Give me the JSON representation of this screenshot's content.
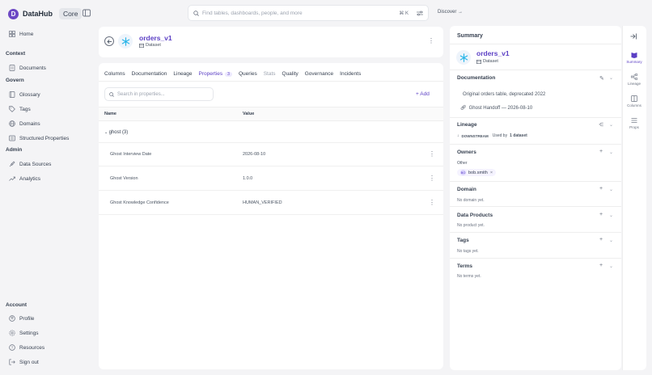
{
  "brand": {
    "name": "DataHub",
    "edition": "Core"
  },
  "search": {
    "placeholder": "Find tables, dashboards, people, and more",
    "shortcut": "⌘ K"
  },
  "discover_label": "Discover →",
  "sidebar": {
    "home": "Home",
    "context_header": "Context",
    "documents": "Documents",
    "govern_header": "Govern",
    "glossary": "Glossary",
    "tags": "Tags",
    "domains": "Domains",
    "structured_properties": "Structured Properties",
    "admin_header": "Admin",
    "data_sources": "Data Sources",
    "analytics": "Analytics",
    "account_header": "Account",
    "profile": "Profile",
    "settings": "Settings",
    "resources": "Resources",
    "sign_out": "Sign out"
  },
  "entity": {
    "name": "orders_v1",
    "type": "Dataset"
  },
  "tabs": [
    {
      "label": "Columns"
    },
    {
      "label": "Documentation"
    },
    {
      "label": "Lineage"
    },
    {
      "label": "Properties",
      "badge": "3"
    },
    {
      "label": "Queries"
    },
    {
      "label": "Stats"
    },
    {
      "label": "Quality"
    },
    {
      "label": "Governance"
    },
    {
      "label": "Incidents"
    }
  ],
  "properties": {
    "search_placeholder": "Search in properties...",
    "add_label": "Add",
    "col_name": "Name",
    "col_value": "Value",
    "group_label": "ghost (3)",
    "rows": [
      {
        "name": "Ghost Interview Date",
        "value": "2026-08-10"
      },
      {
        "name": "Ghost Version",
        "value": "1.0.0"
      },
      {
        "name": "Ghost Knowledge Confidence",
        "value": "HUMAN_VERIFIED"
      }
    ]
  },
  "summary": {
    "title": "Summary",
    "documentation_header": "Documentation",
    "documentation_text": "Original orders table, deprecated 2022",
    "doc_link": "Ghost Handoff — 2026-08-10",
    "lineage_header": "Lineage",
    "downstream_label": "DOWNSTREAM",
    "used_by_prefix": "Used by",
    "used_by_count": "1 dataset",
    "owners_header": "Owners",
    "owners_sub": "Other",
    "owner_initials": "BO",
    "owner_name": "bob.smith",
    "domain_header": "Domain",
    "domain_empty": "No domain yet.",
    "products_header": "Data Products",
    "products_empty": "No product yet.",
    "tags_header": "Tags",
    "tags_empty": "No tags yet.",
    "terms_header": "Terms",
    "terms_empty": "No terms yet."
  },
  "rail": {
    "summary": "Summary",
    "lineage": "Lineage",
    "columns": "Columns",
    "props": "Props"
  },
  "colors": {
    "accent": "#5b3fc4",
    "background": "#f4f4f6"
  }
}
